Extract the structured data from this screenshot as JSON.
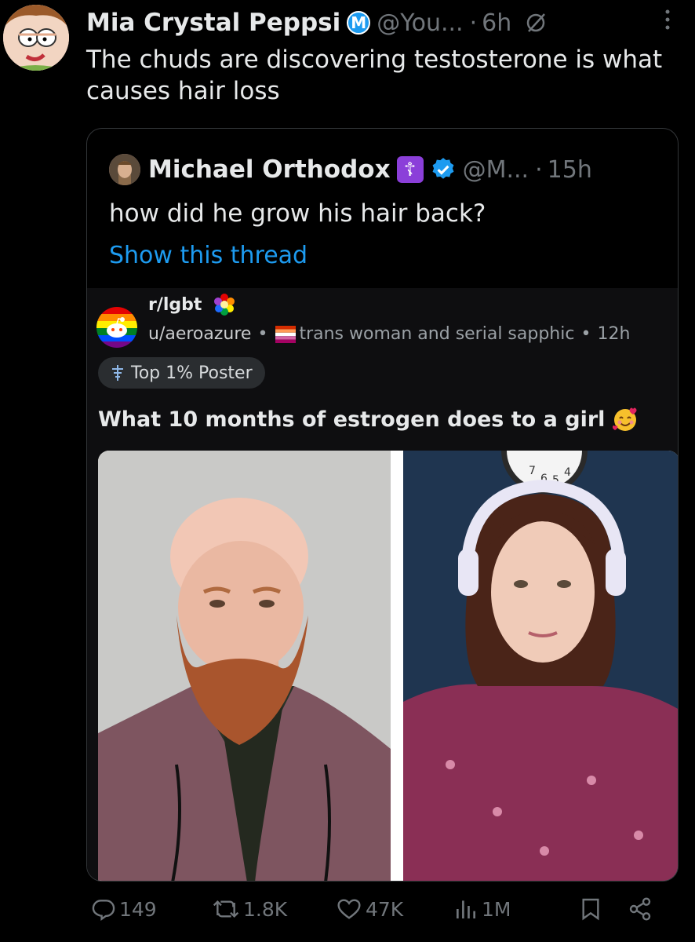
{
  "tweet": {
    "author_name": "Mia Crystal Peppsi",
    "badge_letter": "M",
    "handle": "@You...",
    "separator": "·",
    "time": "6h",
    "text": "The chuds are discovering testosterone is what causes hair loss"
  },
  "quoted_tweet": {
    "author_name": "Michael Orthodox",
    "cross_glyph": "☦",
    "handle": "@M...",
    "separator": "·",
    "time": "15h",
    "text": "how did he grow his hair back?",
    "show_thread_label": "Show this thread"
  },
  "reddit_post": {
    "subreddit": "r/lgbt",
    "username": "u/aeroazure",
    "dot1": "•",
    "flair": "trans woman and serial sapphic",
    "dot2": "•",
    "time": "12h",
    "poster_badge": "Top 1% Poster",
    "title": "What 10 months of estrogen does to a girl",
    "clock_numbers": [
      "7",
      "6",
      "5",
      "4"
    ]
  },
  "actions": {
    "replies": "149",
    "reposts": "1.8K",
    "likes": "47K",
    "views": "1M"
  },
  "colors": {
    "background": "#000000",
    "text": "#e7e9ea",
    "muted": "#71767b",
    "link": "#1d9bf0",
    "reddit_bg": "#0e0e10"
  },
  "icons": [
    "edit-icon",
    "more-icon",
    "verified-icon",
    "reddit-snoo-icon",
    "lesbian-flag-icon",
    "reply-icon",
    "repost-icon",
    "like-icon",
    "views-icon",
    "bookmark-icon",
    "share-icon"
  ]
}
